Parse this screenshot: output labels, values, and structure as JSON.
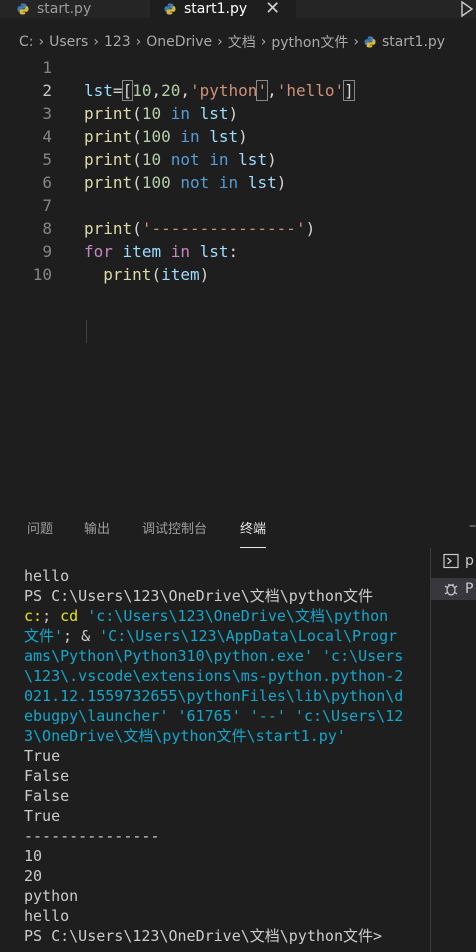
{
  "tabs": [
    {
      "label": "start.py",
      "active": false
    },
    {
      "label": "start1.py",
      "active": true
    }
  ],
  "tab_close_glyph": "✕",
  "breadcrumb": [
    "C:",
    "Users",
    "123",
    "OneDrive",
    "文档",
    "python文件",
    "start1.py"
  ],
  "editor": {
    "line_numbers": [
      "1",
      "2",
      "3",
      "4",
      "5",
      "6",
      "7",
      "8",
      "9",
      "10"
    ],
    "lines": [
      [],
      [
        {
          "t": "lst",
          "c": "var"
        },
        {
          "t": "=",
          "c": "txt"
        },
        {
          "t": "[",
          "c": "txt",
          "b": true
        },
        {
          "t": "10",
          "c": "num"
        },
        {
          "t": ",",
          "c": "txt"
        },
        {
          "t": "20",
          "c": "num"
        },
        {
          "t": ",",
          "c": "txt"
        },
        {
          "t": "'python",
          "c": "str"
        },
        {
          "t": "'",
          "c": "str",
          "b": true
        },
        {
          "t": ",",
          "c": "txt"
        },
        {
          "t": "'hello'",
          "c": "str"
        },
        {
          "t": "]",
          "c": "txt",
          "b": true
        }
      ],
      [
        {
          "t": "print",
          "c": "fn"
        },
        {
          "t": "(",
          "c": "txt"
        },
        {
          "t": "10",
          "c": "num"
        },
        {
          "t": " ",
          "c": "txt"
        },
        {
          "t": "in",
          "c": "kw"
        },
        {
          "t": " ",
          "c": "txt"
        },
        {
          "t": "lst",
          "c": "var"
        },
        {
          "t": ")",
          "c": "txt"
        }
      ],
      [
        {
          "t": "print",
          "c": "fn"
        },
        {
          "t": "(",
          "c": "txt"
        },
        {
          "t": "100",
          "c": "num"
        },
        {
          "t": " ",
          "c": "txt"
        },
        {
          "t": "in",
          "c": "kw"
        },
        {
          "t": " ",
          "c": "txt"
        },
        {
          "t": "lst",
          "c": "var"
        },
        {
          "t": ")",
          "c": "txt"
        }
      ],
      [
        {
          "t": "print",
          "c": "fn"
        },
        {
          "t": "(",
          "c": "txt"
        },
        {
          "t": "10",
          "c": "num"
        },
        {
          "t": " ",
          "c": "txt"
        },
        {
          "t": "not",
          "c": "kw"
        },
        {
          "t": " ",
          "c": "txt"
        },
        {
          "t": "in",
          "c": "kw"
        },
        {
          "t": " ",
          "c": "txt"
        },
        {
          "t": "lst",
          "c": "var"
        },
        {
          "t": ")",
          "c": "txt"
        }
      ],
      [
        {
          "t": "print",
          "c": "fn"
        },
        {
          "t": "(",
          "c": "txt"
        },
        {
          "t": "100",
          "c": "num"
        },
        {
          "t": " ",
          "c": "txt"
        },
        {
          "t": "not",
          "c": "kw"
        },
        {
          "t": " ",
          "c": "txt"
        },
        {
          "t": "in",
          "c": "kw"
        },
        {
          "t": " ",
          "c": "txt"
        },
        {
          "t": "lst",
          "c": "var"
        },
        {
          "t": ")",
          "c": "txt"
        }
      ],
      [],
      [
        {
          "t": "print",
          "c": "fn"
        },
        {
          "t": "(",
          "c": "txt"
        },
        {
          "t": "'---------------'",
          "c": "str"
        },
        {
          "t": ")",
          "c": "txt"
        }
      ],
      [
        {
          "t": "for",
          "c": "kw2"
        },
        {
          "t": " ",
          "c": "txt"
        },
        {
          "t": "item",
          "c": "var"
        },
        {
          "t": " ",
          "c": "txt"
        },
        {
          "t": "in",
          "c": "kw2"
        },
        {
          "t": " ",
          "c": "txt"
        },
        {
          "t": "lst",
          "c": "var"
        },
        {
          "t": ":",
          "c": "txt"
        }
      ],
      [
        {
          "t": "  ",
          "c": "txt"
        },
        {
          "t": "print",
          "c": "fn"
        },
        {
          "t": "(",
          "c": "txt"
        },
        {
          "t": "item",
          "c": "var"
        },
        {
          "t": ")",
          "c": "txt"
        }
      ]
    ]
  },
  "panel": {
    "tabs": [
      "问题",
      "输出",
      "调试控制台",
      "终端"
    ],
    "active_tab": "终端",
    "dash": "–"
  },
  "terminal": {
    "lines": [
      [
        {
          "t": "hello",
          "c": ""
        }
      ],
      [
        {
          "t": "PS C:\\Users\\123\\OneDrive\\文档\\python文件",
          "c": ""
        }
      ],
      [
        {
          "t": "c:",
          "c": "yellow"
        },
        {
          "t": "; ",
          "c": ""
        },
        {
          "t": "cd",
          "c": "yellow"
        },
        {
          "t": " ",
          "c": ""
        },
        {
          "t": "'c:\\Users\\123\\OneDrive\\文档\\python",
          "c": "cyan"
        }
      ],
      [
        {
          "t": "文件'",
          "c": "cyan"
        },
        {
          "t": "; & ",
          "c": ""
        },
        {
          "t": "'C:\\Users\\123\\AppData\\Local\\Progr",
          "c": "cyan"
        }
      ],
      [
        {
          "t": "ams\\Python\\Python310\\python.exe' 'c:\\Users",
          "c": "cyan"
        }
      ],
      [
        {
          "t": "\\123\\.vscode\\extensions\\ms-python.python-2",
          "c": "cyan"
        }
      ],
      [
        {
          "t": "021.12.1559732655\\pythonFiles\\lib\\python\\d",
          "c": "cyan"
        }
      ],
      [
        {
          "t": "ebugpy\\launcher' '61765' '--' 'c:\\Users\\12",
          "c": "cyan"
        }
      ],
      [
        {
          "t": "3\\OneDrive\\文档\\python文件\\start1.py'",
          "c": "cyan"
        }
      ],
      [
        {
          "t": "True",
          "c": ""
        }
      ],
      [
        {
          "t": "False",
          "c": ""
        }
      ],
      [
        {
          "t": "False",
          "c": ""
        }
      ],
      [
        {
          "t": "True",
          "c": ""
        }
      ],
      [
        {
          "t": "---------------",
          "c": ""
        }
      ],
      [
        {
          "t": "10",
          "c": ""
        }
      ],
      [
        {
          "t": "20",
          "c": ""
        }
      ],
      [
        {
          "t": "python",
          "c": ""
        }
      ],
      [
        {
          "t": "hello",
          "c": ""
        }
      ],
      [
        {
          "t": "PS C:\\Users\\123\\OneDrive\\文档\\python文件>",
          "c": ""
        }
      ]
    ]
  },
  "terminal_side": {
    "items": [
      {
        "label": "p",
        "icon": "terminal-icon",
        "selected": false
      },
      {
        "label": "P",
        "icon": "debug-icon",
        "selected": true
      }
    ]
  }
}
